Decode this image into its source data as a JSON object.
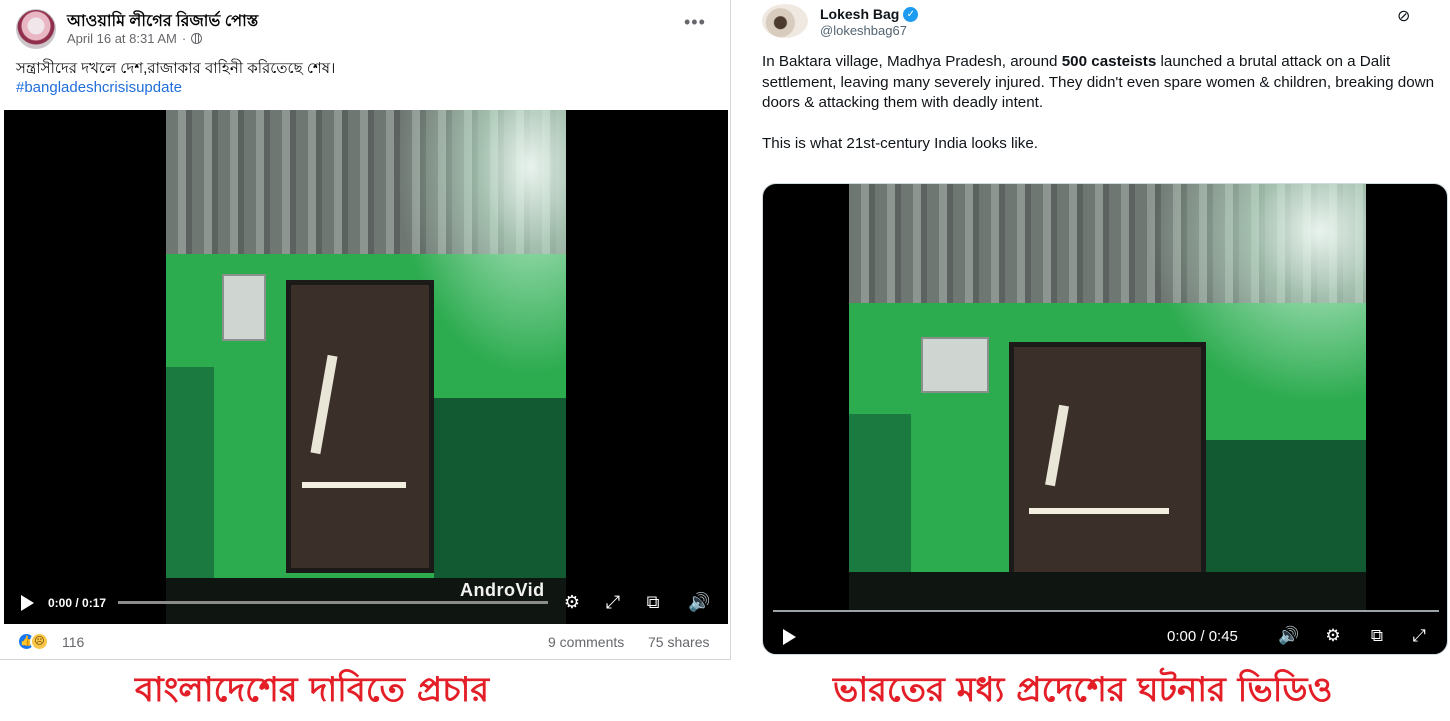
{
  "facebook_post": {
    "page_name": "আওয়ামি লীগের রিজার্ভ পোস্ত",
    "date": "April 16 at 8:31 AM",
    "more_icon": "more-options-icon",
    "caption": "সন্ত্রাসীদের দখলে দেশ,রাজাকার বাহিনী করিতেছে শেষ।",
    "hashtag": "#bangladeshcrisisupdate",
    "video": {
      "time": "0:00 / 0:17",
      "progress": 0,
      "watermark": "AndroVid",
      "icons": [
        "play-icon",
        "settings-icon",
        "fullscreen-icon",
        "pip-icon",
        "volume-icon"
      ]
    },
    "reactions": {
      "count": "116",
      "icons": [
        "like-icon",
        "sad-icon"
      ]
    },
    "comments": "9 comments",
    "shares": "75 shares"
  },
  "x_post": {
    "name": "Lokesh Bag",
    "handle": "@lokeshbag67",
    "text_pre": "In Baktara village, Madhya Pradesh, around ",
    "text_bold": "500 casteists",
    "text_post": " launched a brutal attack on a Dalit settlement, leaving many severely injured. They didn't even spare women & children, breaking down doors & attacking them with deadly intent.",
    "text_line2": "This is what 21st-century India looks like.",
    "video": {
      "time": "0:00 / 0:45",
      "progress": 0,
      "icons": [
        "play-icon",
        "volume-icon",
        "settings-icon",
        "pip-icon",
        "fullscreen-icon"
      ]
    }
  },
  "captions": {
    "left": "বাংলাদেশের দাবিতে প্রচার",
    "right": "ভারতের মধ্য প্রদেশের ঘটনার ভিডিও"
  },
  "colors": {
    "caption_red": "#e41e26",
    "fb_link_blue": "#216fdb",
    "x_verified_blue": "#1d9bf0"
  }
}
